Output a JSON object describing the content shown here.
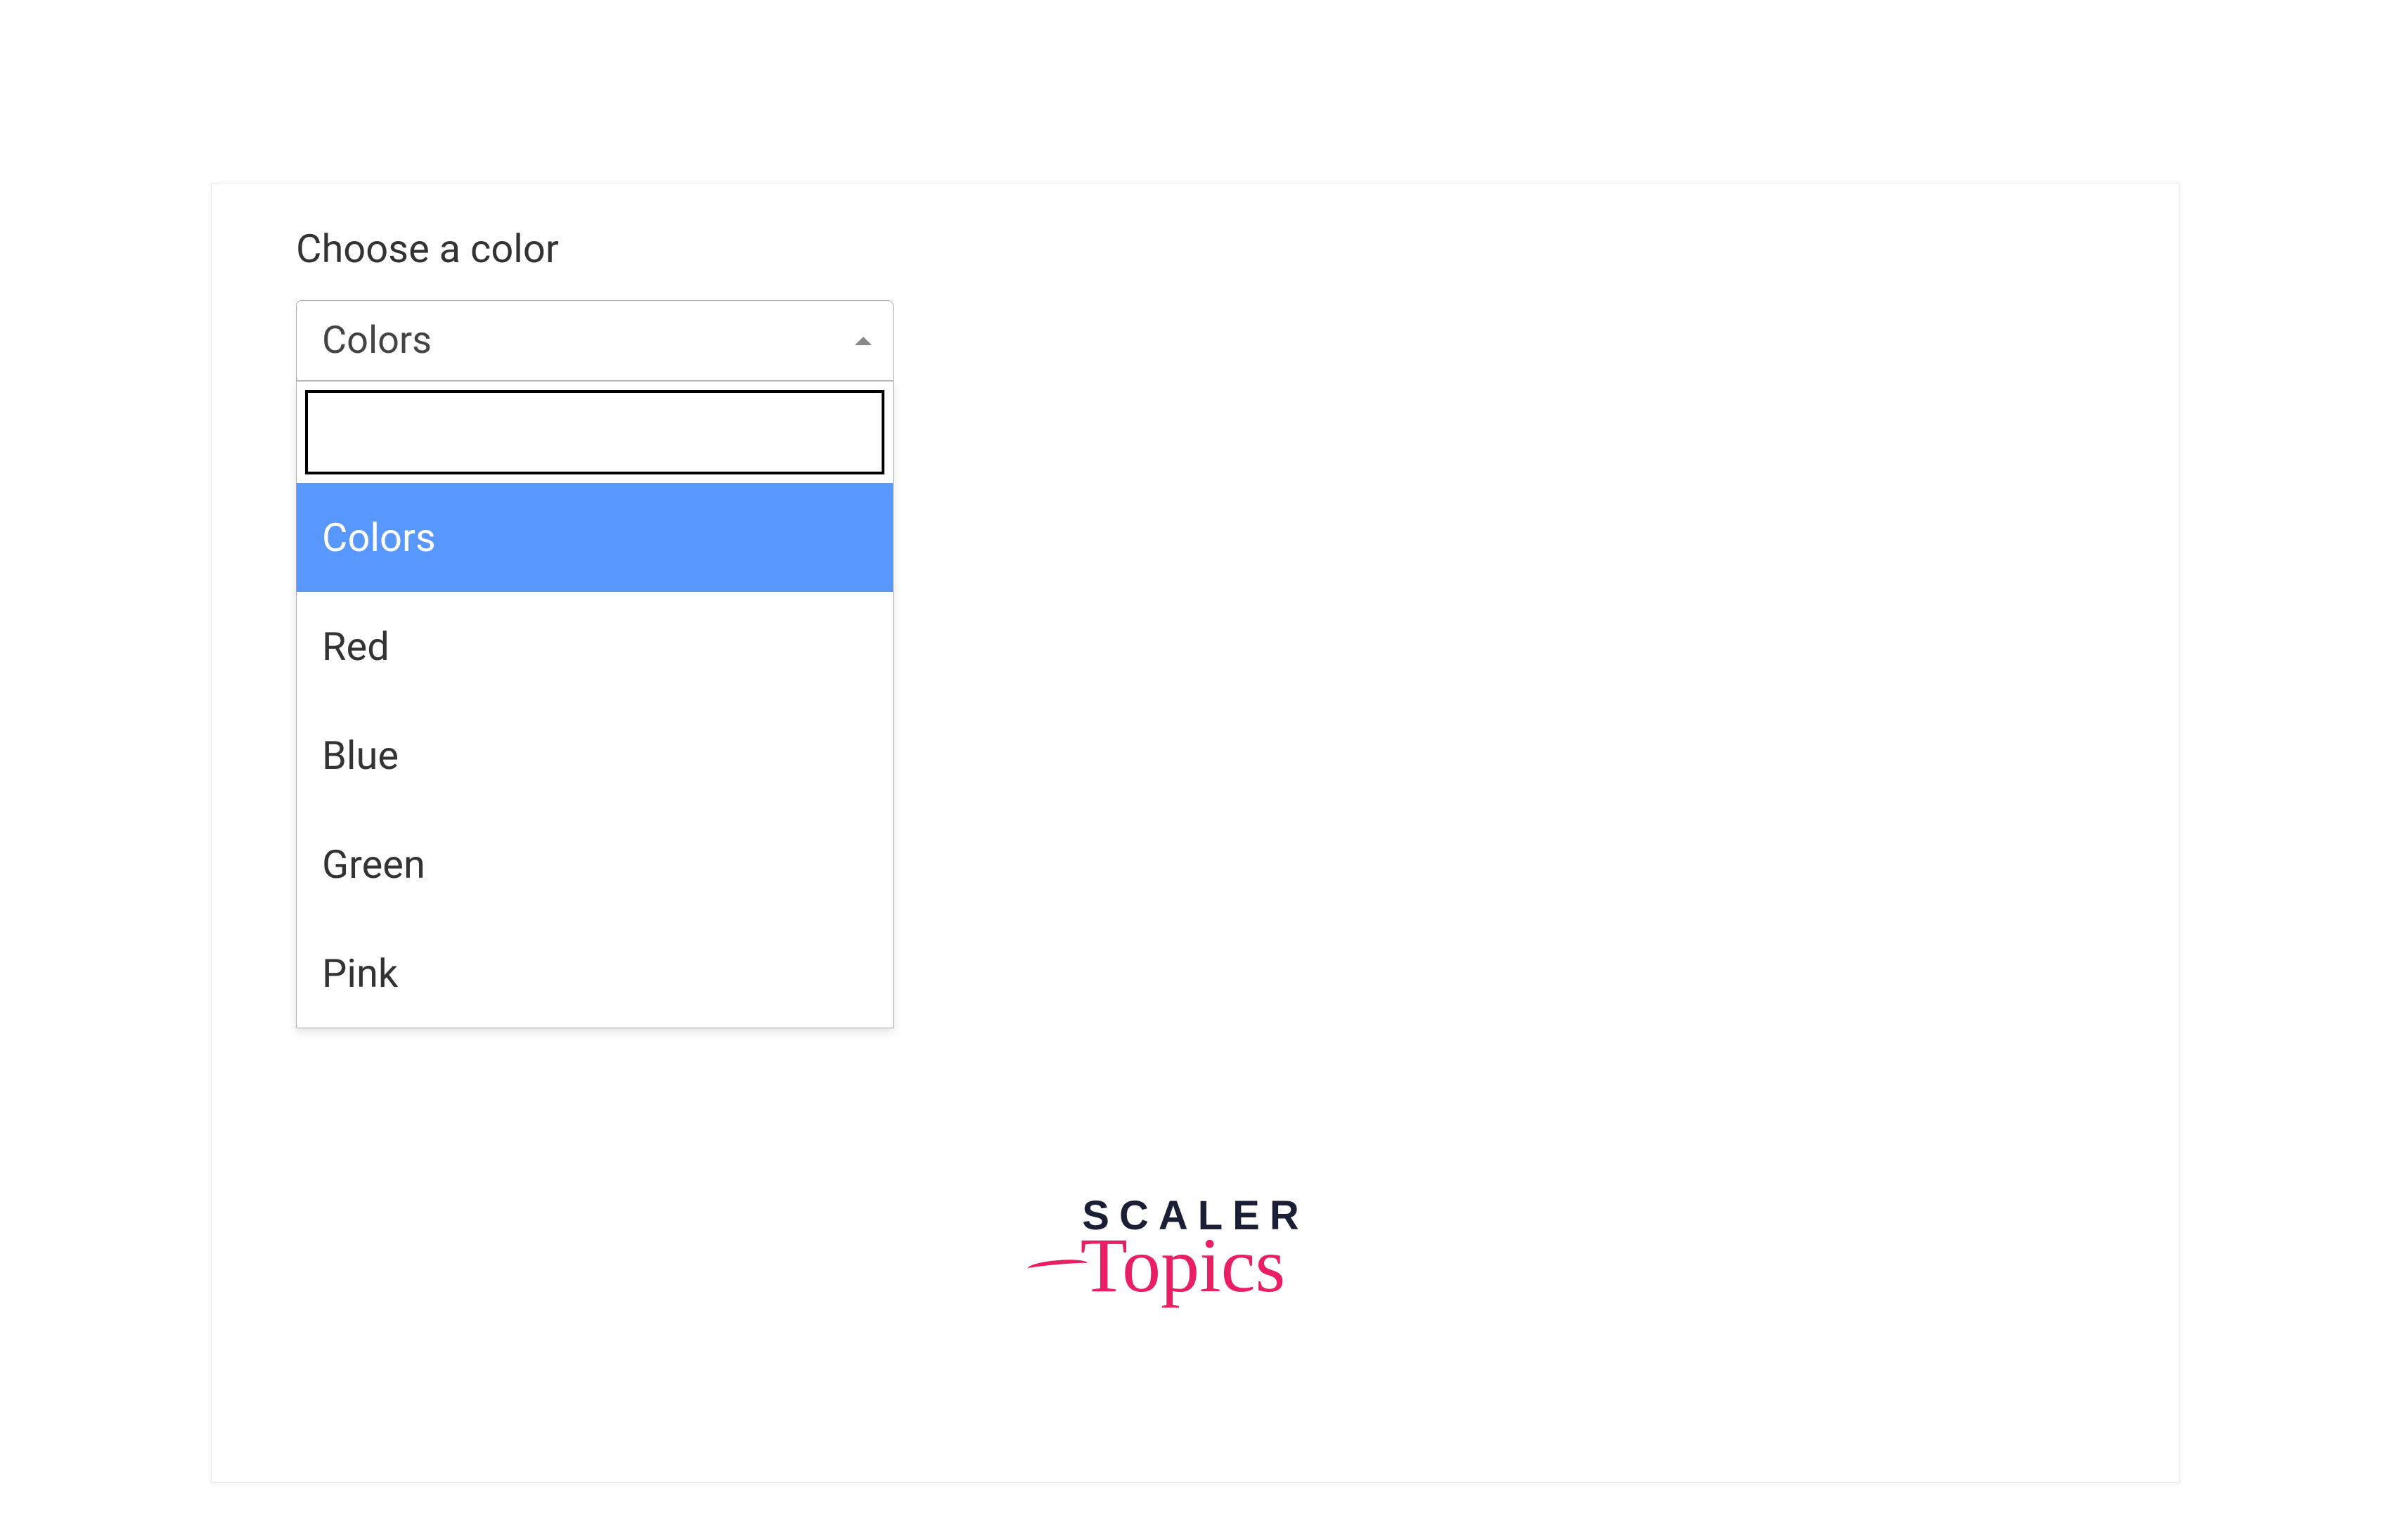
{
  "form": {
    "label": "Choose a color",
    "select": {
      "selected": "Colors",
      "search_value": "",
      "search_placeholder": "",
      "options": [
        {
          "label": "Colors",
          "highlighted": true
        },
        {
          "label": "Red",
          "highlighted": false
        },
        {
          "label": "Blue",
          "highlighted": false
        },
        {
          "label": "Green",
          "highlighted": false
        },
        {
          "label": "Pink",
          "highlighted": false
        }
      ]
    }
  },
  "logo": {
    "line1": "SCALER",
    "line2": "Topics"
  },
  "colors": {
    "highlight": "#5897fb",
    "logo_dark": "#1a1f36",
    "logo_accent": "#e91e63"
  }
}
